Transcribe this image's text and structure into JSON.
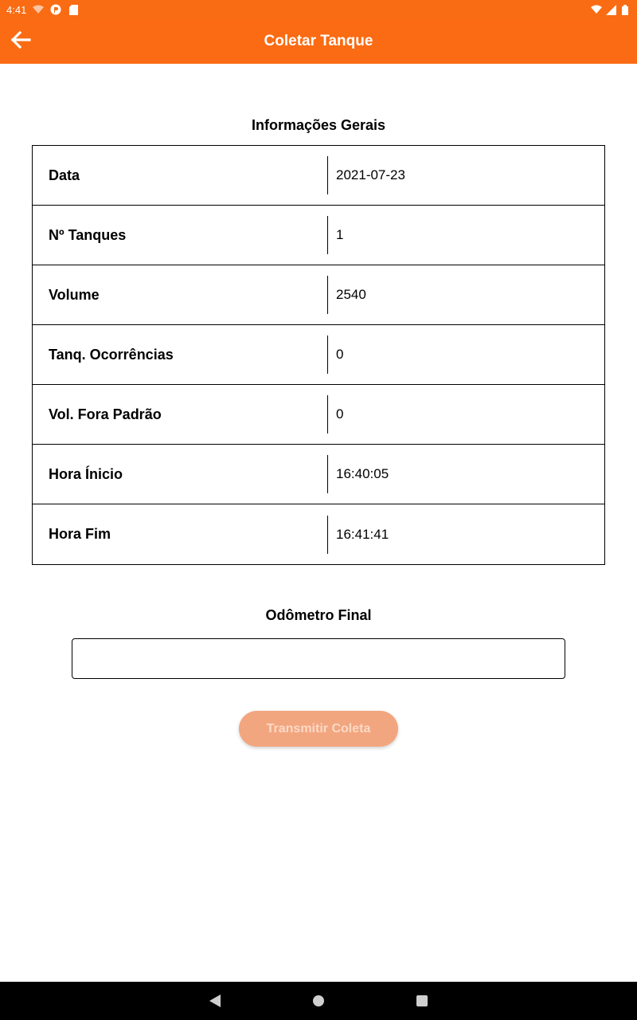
{
  "status_bar": {
    "time": "4:41",
    "icons": [
      "wifi-off-icon",
      "app-icon",
      "sd-card-icon"
    ],
    "right_icons": [
      "wifi-icon",
      "signal-icon",
      "battery-icon"
    ]
  },
  "app_bar": {
    "title": "Coletar Tanque",
    "back_icon": "arrow-left-icon"
  },
  "general_info": {
    "title": "Informações Gerais",
    "rows": [
      {
        "label": "Data",
        "value": "2021-07-23"
      },
      {
        "label": "Nº Tanques",
        "value": "1"
      },
      {
        "label": "Volume",
        "value": "2540"
      },
      {
        "label": "Tanq. Ocorrências",
        "value": "0"
      },
      {
        "label": "Vol. Fora Padrão",
        "value": "0"
      },
      {
        "label": "Hora Ínicio",
        "value": "16:40:05"
      },
      {
        "label": "Hora Fim",
        "value": "16:41:41"
      }
    ]
  },
  "odometer": {
    "title": "Odômetro Final",
    "value": "",
    "placeholder": ""
  },
  "submit": {
    "label": "Transmitir Coleta",
    "enabled": false
  },
  "colors": {
    "primary": "#fa6b13",
    "button_disabled": "#f2a67f"
  },
  "nav_bar": {
    "icons": [
      "back-triangle-icon",
      "home-circle-icon",
      "recents-square-icon"
    ]
  }
}
